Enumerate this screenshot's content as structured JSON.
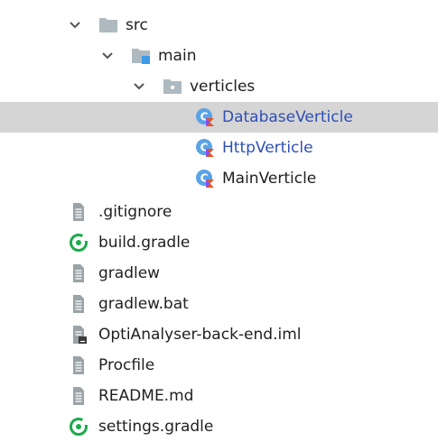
{
  "tree": {
    "folders": [
      {
        "label": "src",
        "icon": "folder-icon"
      },
      {
        "label": "main",
        "icon": "source-folder-icon"
      },
      {
        "label": "verticles",
        "icon": "package-folder-icon"
      }
    ],
    "kotlin_files": [
      {
        "label": "DatabaseVerticle",
        "icon": "kotlin-class-icon",
        "selected": true
      },
      {
        "label": "HttpVerticle",
        "icon": "kotlin-class-icon"
      },
      {
        "label": "MainVerticle",
        "icon": "kotlin-class-icon"
      }
    ],
    "root_files": [
      {
        "label": ".gitignore",
        "icon": "text-file-icon"
      },
      {
        "label": "build.gradle",
        "icon": "gradle-icon"
      },
      {
        "label": "gradlew",
        "icon": "text-file-icon"
      },
      {
        "label": "gradlew.bat",
        "icon": "text-file-icon"
      },
      {
        "label": "OptiAnalyser-back-end.iml",
        "icon": "module-file-icon"
      },
      {
        "label": "Procfile",
        "icon": "text-file-icon"
      },
      {
        "label": "README.md",
        "icon": "text-file-icon"
      },
      {
        "label": "settings.gradle",
        "icon": "gradle-icon"
      }
    ]
  },
  "colors": {
    "selection": "#d5d5d5",
    "modified_text": "#2f4fb4",
    "kotlin_blue": "#5aa3e6",
    "gradle_green": "#1bab4c"
  }
}
